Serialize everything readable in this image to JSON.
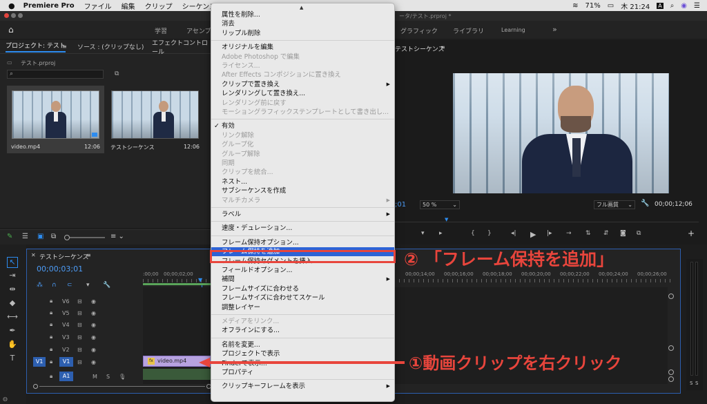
{
  "menubar": {
    "app": "Premiere Pro",
    "items": [
      "ファイル",
      "編集",
      "クリップ",
      "シーケンス"
    ],
    "battery": "71%",
    "clock": "木 21:24"
  },
  "titlebar": {
    "path": "ータ/テスト.prproj *"
  },
  "workspace": {
    "tabs": [
      "学習",
      "アセンブ",
      "グラフィック",
      "ライブラリ",
      "Learning"
    ],
    "more": "»"
  },
  "project_panel": {
    "tabs": [
      "プロジェクト: テスト",
      "ソース : (クリップなし)",
      "エフェクトコントロール"
    ],
    "project_file": "テスト.prproj",
    "items": [
      {
        "name": "video.mp4",
        "duration": "12:06"
      },
      {
        "name": "テストシーケンス",
        "duration": "12:06"
      }
    ]
  },
  "program_monitor": {
    "tab": "テストシーケンス",
    "timecode_left": ";01",
    "zoom": "50 %",
    "quality": "フル画質",
    "timecode_right": "00;00;12;06"
  },
  "timeline": {
    "tab": "テストシーケンス",
    "timecode": "00;00;03;01",
    "ruler": [
      ":00;00",
      "00;00;02;00",
      "00;00;14;00",
      "00;00;16;00",
      "00;00;18;00",
      "00;00;20;00",
      "00;00;22;00",
      "00;00;24;00",
      "00;00;26;00"
    ],
    "video_tracks": [
      "V6",
      "V5",
      "V4",
      "V3",
      "V2",
      "V1"
    ],
    "source_v": "V1",
    "audio_track": "A1",
    "audio_buttons": [
      "M",
      "S"
    ],
    "clip_label": "video.mp4",
    "meter_labels": [
      "S",
      "S"
    ]
  },
  "context_menu": {
    "items": [
      {
        "label": "属性を削除...",
        "disabled": false
      },
      {
        "label": "消去",
        "disabled": false
      },
      {
        "label": "リップル削除",
        "disabled": false
      },
      {
        "sep": true
      },
      {
        "label": "オリジナルを編集",
        "disabled": false
      },
      {
        "label": "Adobe Photoshop で編集",
        "disabled": true
      },
      {
        "label": "ライセンス...",
        "disabled": true
      },
      {
        "label": "After Effects コンポジションに置き換え",
        "disabled": true
      },
      {
        "label": "クリップで置き換え",
        "disabled": false,
        "submenu": true
      },
      {
        "label": "レンダリングして置き換え...",
        "disabled": false
      },
      {
        "label": "レンダリング前に戻す",
        "disabled": true
      },
      {
        "label": "モーショングラフィックステンプレートとして書き出し...",
        "disabled": true
      },
      {
        "sep": true
      },
      {
        "label": "有効",
        "disabled": false,
        "checked": true
      },
      {
        "label": "リンク解除",
        "disabled": true
      },
      {
        "label": "グループ化",
        "disabled": true
      },
      {
        "label": "グループ解除",
        "disabled": true
      },
      {
        "label": "同期",
        "disabled": true
      },
      {
        "label": "クリップを統合...",
        "disabled": true
      },
      {
        "label": "ネスト...",
        "disabled": false
      },
      {
        "label": "サブシーケンスを作成",
        "disabled": false
      },
      {
        "label": "マルチカメラ",
        "disabled": true,
        "submenu": true
      },
      {
        "sep": true
      },
      {
        "label": "ラベル",
        "disabled": false,
        "submenu": true
      },
      {
        "sep": true
      },
      {
        "label": "速度・デュレーション...",
        "disabled": false
      },
      {
        "sep": true
      },
      {
        "label": "フレーム保持オプション...",
        "disabled": false
      },
      {
        "label": "フレーム保持を追加",
        "disabled": false,
        "selected": true
      },
      {
        "label": "フレーム保持セグメントを挿入",
        "disabled": false
      },
      {
        "label": "フィールドオプション...",
        "disabled": false
      },
      {
        "label": "補間",
        "disabled": false,
        "submenu": true
      },
      {
        "label": "フレームサイズに合わせる",
        "disabled": false
      },
      {
        "label": "フレームサイズに合わせてスケール",
        "disabled": false
      },
      {
        "label": "調整レイヤー",
        "disabled": false
      },
      {
        "sep": true
      },
      {
        "label": "メディアをリンク...",
        "disabled": true
      },
      {
        "label": "オフラインにする...",
        "disabled": false
      },
      {
        "sep": true
      },
      {
        "label": "名前を変更...",
        "disabled": false
      },
      {
        "label": "プロジェクトで表示",
        "disabled": false
      },
      {
        "label": "Finderで表示...",
        "disabled": false
      },
      {
        "label": "プロパティ",
        "disabled": false
      },
      {
        "sep": true
      },
      {
        "label": "クリップキーフレームを表示",
        "disabled": false,
        "submenu": true
      }
    ]
  },
  "annotations": {
    "step2": "② 「フレーム保持を追加」",
    "step1": "①動画クリップを右クリック",
    "color": "#e8453c"
  },
  "colors": {
    "menu_highlight": "#2c63d6",
    "clip": "#b7a3e0",
    "accent_blue": "#2d8cf0"
  }
}
